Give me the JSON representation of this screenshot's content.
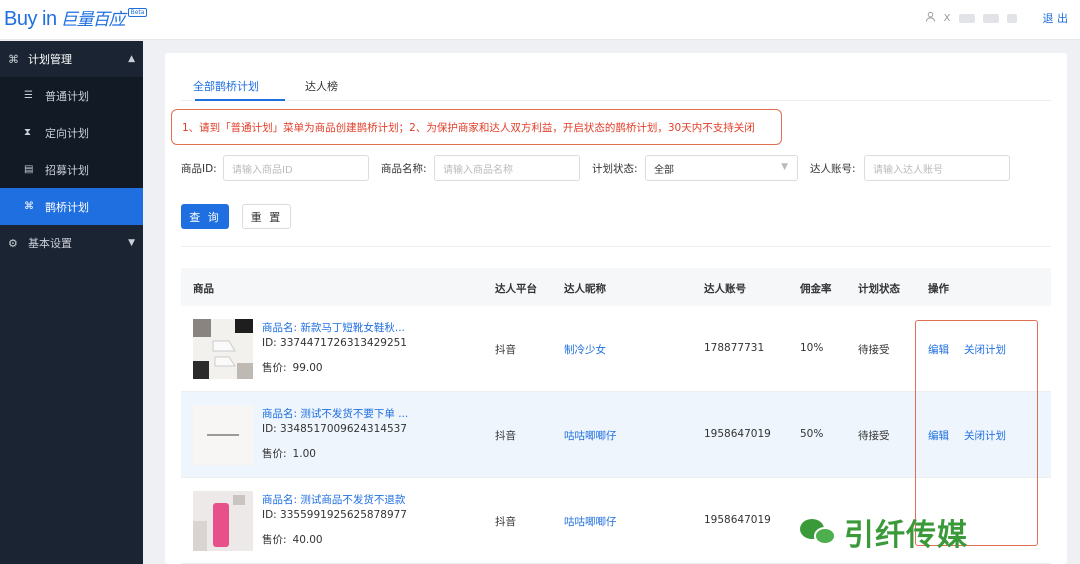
{
  "header": {
    "logo_text": "Buy in",
    "logo_cn": "巨量百应",
    "logo_badge": "Beta",
    "user_text": "X",
    "logout_label": "退 出"
  },
  "sidebar": {
    "group_plan": "计划管理",
    "items": [
      {
        "label": "普通计划",
        "icon": "list-icon"
      },
      {
        "label": "定向计划",
        "icon": "hourglass-icon"
      },
      {
        "label": "招募计划",
        "icon": "recruit-icon"
      },
      {
        "label": "鹊桥计划",
        "icon": "bridge-icon"
      }
    ],
    "group_settings": "基本设置"
  },
  "tabs": [
    "全部鹊桥计划",
    "达人榜"
  ],
  "notice": "1、请到「普通计划」菜单为商品创建鹊桥计划；2、为保护商家和达人双方利益，开启状态的鹊桥计划，30天内不支持关闭",
  "filters": {
    "product_id_label": "商品ID:",
    "product_id_placeholder": "请输入商品ID",
    "product_name_label": "商品名称:",
    "product_name_placeholder": "请输入商品名称",
    "status_label": "计划状态:",
    "status_value": "全部",
    "account_label": "达人账号:",
    "account_placeholder": "请输入达人账号"
  },
  "buttons": {
    "query": "查 询",
    "reset": "重 置"
  },
  "table": {
    "headers": [
      "商品",
      "达人平台",
      "达人昵称",
      "达人账号",
      "佣金率",
      "计划状态",
      "操作"
    ],
    "name_prefix": "商品名: ",
    "id_prefix": "ID: ",
    "price_label": "售价:",
    "rows": [
      {
        "name": "商品名: 新款马丁短靴女鞋秋...",
        "id": "ID: 3374471726313429251",
        "price": "99.00",
        "platform": "抖音",
        "nickname": "制冷少女",
        "account": "178877731",
        "commission": "10%",
        "status": "待接受",
        "edit": "编辑",
        "close": "关闭计划"
      },
      {
        "name": "商品名: 测试不发货不要下单 ...",
        "id": "ID: 3348517009624314537",
        "price": "1.00",
        "platform": "抖音",
        "nickname": "咕咕唧唧仔",
        "account": "1958647019",
        "commission": "50%",
        "status": "待接受",
        "edit": "编辑",
        "close": "关闭计划"
      },
      {
        "name": "商品名: 测试商品不发货不退款",
        "id": "ID: 3355991925625878977",
        "price": "40.00",
        "platform": "抖音",
        "nickname": "咕咕唧唧仔",
        "account": "1958647019",
        "commission": "",
        "status": "",
        "edit": "",
        "close": ""
      }
    ]
  },
  "watermark": "引纤传媒",
  "colors": {
    "accent": "#1f6fe0",
    "sidebar": "#1b2433",
    "notice": "#e23f2a",
    "highlight_box": "#e07052"
  }
}
